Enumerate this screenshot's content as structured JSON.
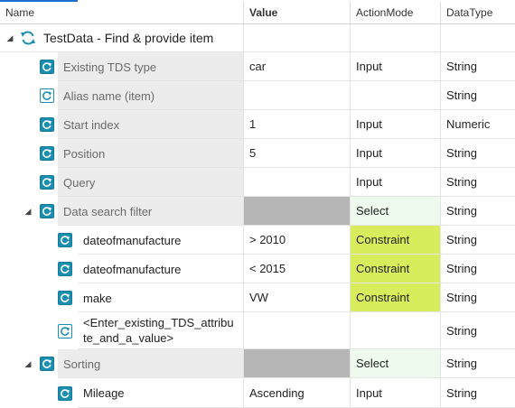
{
  "header": {
    "name": "Name",
    "value": "Value",
    "actionmode": "ActionMode",
    "datatype": "DataType"
  },
  "root": {
    "label": "TestData - Find & provide item",
    "icon": "refresh-icon"
  },
  "rows": [
    {
      "name": "Existing TDS type",
      "value": "car",
      "mode": "Input",
      "type": "String"
    },
    {
      "name": "Alias name (item)",
      "value": "",
      "mode": "",
      "type": "String"
    },
    {
      "name": "Start index",
      "value": "1",
      "mode": "Input",
      "type": "Numeric"
    },
    {
      "name": "Position",
      "value": "5",
      "mode": "Input",
      "type": "String"
    },
    {
      "name": "Query",
      "value": "",
      "mode": "Input",
      "type": "String"
    },
    {
      "name": "Data search filter",
      "value": "",
      "mode": "Select",
      "type": "String"
    },
    {
      "name": "dateofmanufacture",
      "value": "> 2010",
      "mode": "Constraint",
      "type": "String"
    },
    {
      "name": "dateofmanufacture",
      "value": "< 2015",
      "mode": "Constraint",
      "type": "String"
    },
    {
      "name": "make",
      "value": "VW",
      "mode": "Constraint",
      "type": "String"
    },
    {
      "name": "<Enter_existing_TDS_attribute_and_a_value>",
      "name_line1": "<Enter_existing_TDS_attribu",
      "name_line2": "te_and_a_value>",
      "value": "",
      "mode": "",
      "type": "String"
    },
    {
      "name": "Sorting",
      "value": "",
      "mode": "Select",
      "type": "String"
    },
    {
      "name": "Mileage",
      "value": "Ascending",
      "mode": "Input",
      "type": "String"
    }
  ],
  "colors": {
    "accent": "#1c8fb0",
    "constraint": "#d9ec5c",
    "select": "#eefaee",
    "grey_block": "#b5b5b5"
  }
}
